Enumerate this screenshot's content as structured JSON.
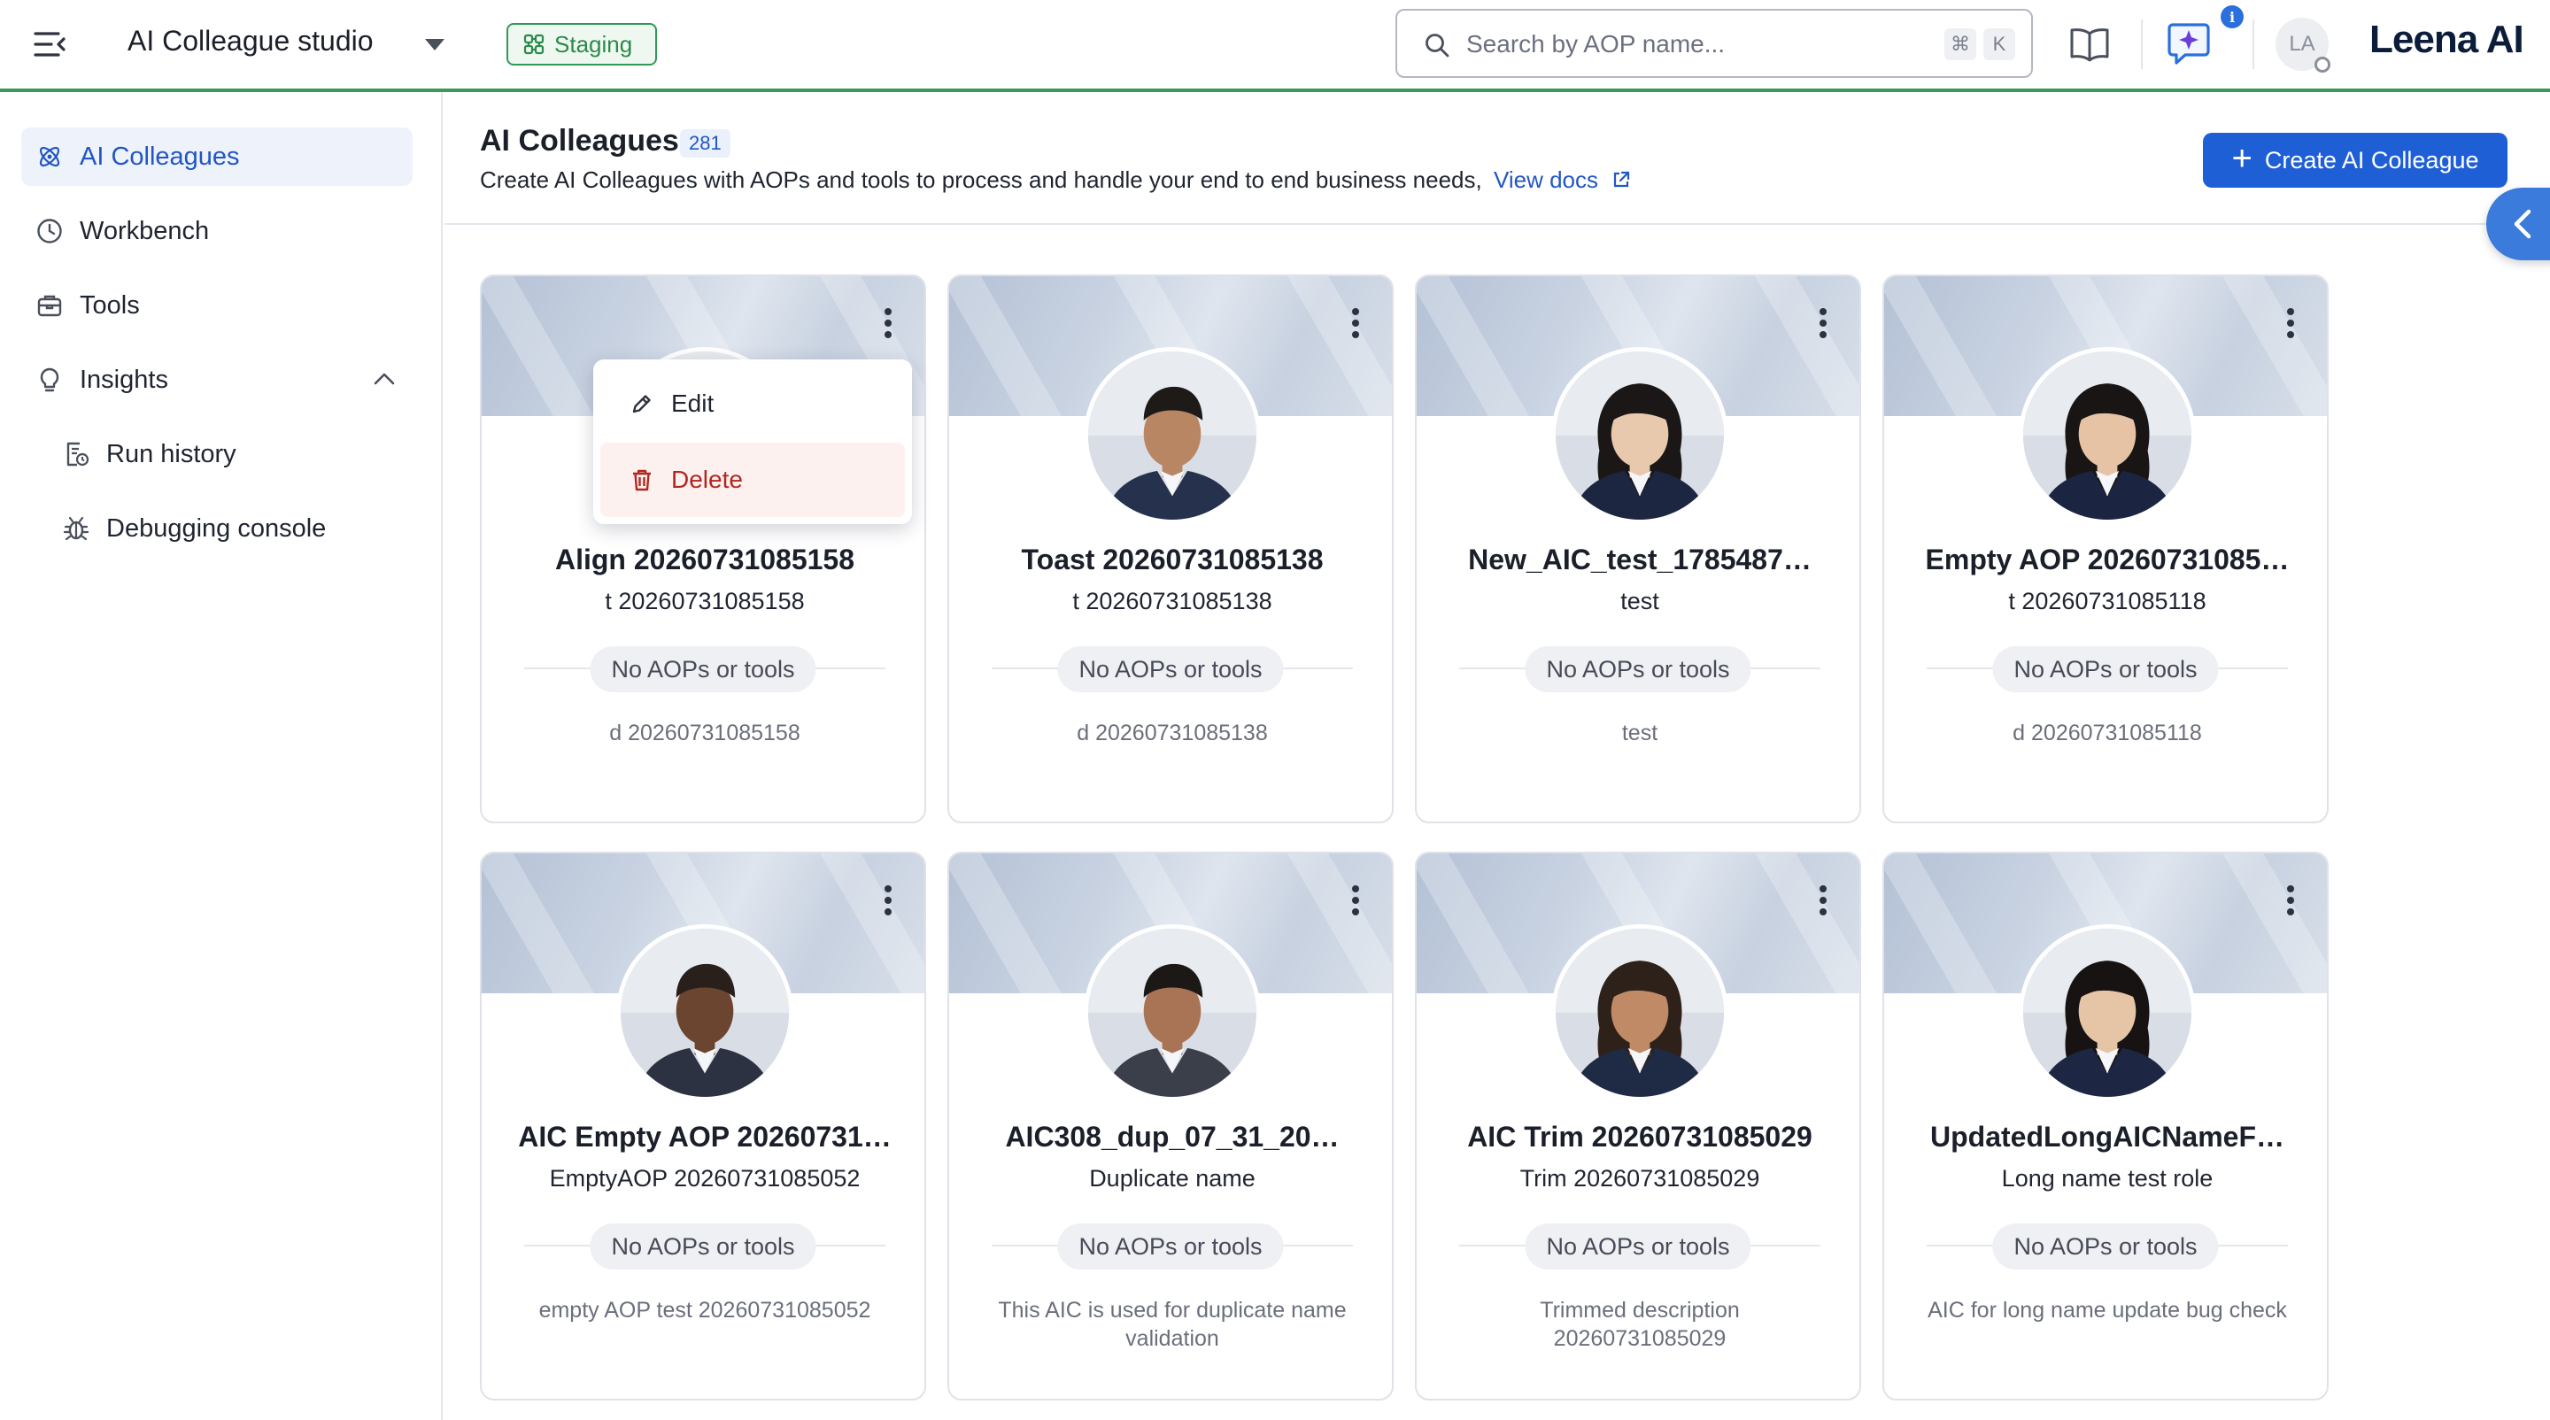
{
  "header": {
    "app_title": "AI Colleague studio",
    "environment_badge": "Staging",
    "search_placeholder": "Search by AOP name...",
    "shortcut_keys": [
      "⌘",
      "K"
    ],
    "notification_badge": "i",
    "user_initials": "LA",
    "brand": "Leena AI"
  },
  "sidebar": {
    "items": [
      {
        "label": "AI Colleagues",
        "icon": "atom-icon",
        "active": true
      },
      {
        "label": "Workbench",
        "icon": "chart-clock-icon"
      },
      {
        "label": "Tools",
        "icon": "toolbox-icon"
      },
      {
        "label": "Insights",
        "icon": "bulb-icon",
        "expanded": true
      },
      {
        "label": "Run history",
        "icon": "file-clock-icon",
        "sub": true
      },
      {
        "label": "Debugging console",
        "icon": "bug-icon",
        "sub": true
      }
    ]
  },
  "page": {
    "title": "AI Colleagues",
    "count": "281",
    "description": "Create AI Colleagues with AOPs and tools to process and handle your end to end business needs,",
    "docs_link": "View docs",
    "create_button": "Create AI Colleague"
  },
  "context_menu": {
    "edit": "Edit",
    "delete": "Delete"
  },
  "cards": [
    {
      "name": "Align 20260731085158",
      "role": "t 20260731085158",
      "tools": "No AOPs or tools",
      "desc": "d 20260731085158",
      "skin": "#c99a7a",
      "hair": "#2b2522",
      "suit": "#1f2a44",
      "female": false
    },
    {
      "name": "Toast 20260731085138",
      "role": "t 20260731085138",
      "tools": "No AOPs or tools",
      "desc": "d 20260731085138",
      "skin": "#b98664",
      "hair": "#1d1a18",
      "suit": "#25314d",
      "female": false
    },
    {
      "name": "New_AIC_test_1785487…",
      "role": "test",
      "tools": "No AOPs or tools",
      "desc": "test",
      "skin": "#e9c9ad",
      "hair": "#1a1716",
      "suit": "#1d2640",
      "female": true
    },
    {
      "name": "Empty AOP 20260731085…",
      "role": "t 20260731085118",
      "tools": "No AOPs or tools",
      "desc": "d 20260731085118",
      "skin": "#e6c3a4",
      "hair": "#181514",
      "suit": "#1b2440",
      "female": true
    },
    {
      "name": "AIC Empty AOP 20260731…",
      "role": "EmptyAOP 20260731085052",
      "tools": "No AOPs or tools",
      "desc": "empty AOP test 20260731085052",
      "skin": "#6b4530",
      "hair": "#2a201b",
      "suit": "#2c3242",
      "female": false
    },
    {
      "name": "AIC308_dup_07_31_20…",
      "role": "Duplicate name",
      "tools": "No AOPs or tools",
      "desc": "This AIC is used for duplicate name validation",
      "skin": "#a87455",
      "hair": "#1c1816",
      "suit": "#3a3f4a",
      "female": false
    },
    {
      "name": "AIC Trim 20260731085029",
      "role": "Trim 20260731085029",
      "tools": "No AOPs or tools",
      "desc": "Trimmed description 20260731085029",
      "skin": "#c08a66",
      "hair": "#2e211a",
      "suit": "#1f2a44",
      "female": true
    },
    {
      "name": "UpdatedLongAICNameF…",
      "role": "Long name test role",
      "tools": "No AOPs or tools",
      "desc": "AIC for long name update bug check",
      "skin": "#e6c4a6",
      "hair": "#161312",
      "suit": "#1d2642",
      "female": true
    }
  ]
}
